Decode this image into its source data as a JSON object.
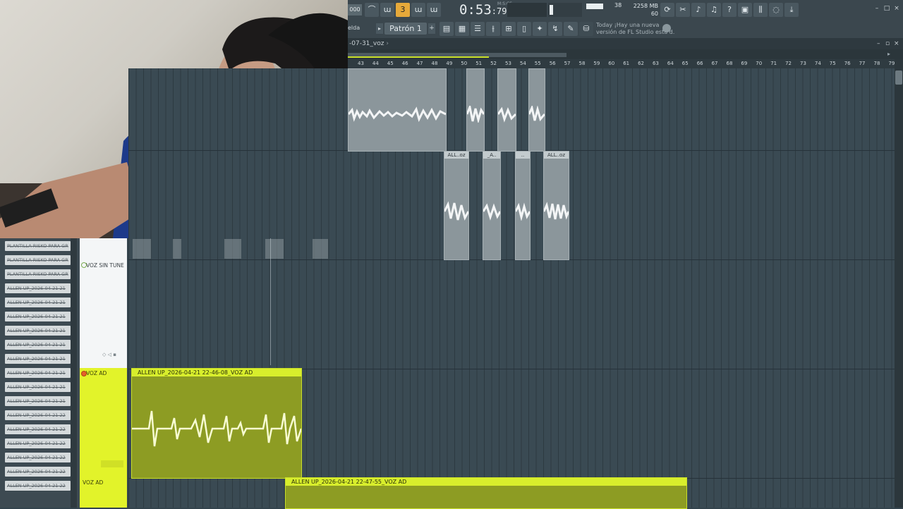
{
  "toolbar": {
    "clock_main": "0:53",
    "clock_sub": "79",
    "clock_unit": "M:S:CS",
    "cpu_voices": "38",
    "mem_value": "2258 MB",
    "mem_poly": "60",
    "left_value": "000",
    "buttons": [
      "line-icon",
      "wo-icon",
      "snap-icon",
      "wplus-icon",
      "wo2-icon"
    ],
    "right_buttons": [
      "refresh-icon",
      "cut-icon",
      "mic-icon",
      "mic2-icon",
      "help-icon",
      "save-icon",
      "mixer-icon",
      "chat-icon",
      "download-icon"
    ]
  },
  "toolbar2": {
    "left_label": "elda",
    "pattern_label": "Patrón 1",
    "hint_line1": "Today  ¡Hay una nueva",
    "hint_line2": "versión de FL Studio está d."
  },
  "playlist": {
    "title": "-07-31_voz",
    "ruler": [
      "43",
      "44",
      "45",
      "46",
      "47",
      "48",
      "49",
      "50",
      "51",
      "52",
      "53",
      "54",
      "55",
      "56",
      "57",
      "58",
      "59",
      "60",
      "61",
      "62",
      "63",
      "64",
      "65",
      "66",
      "67",
      "68",
      "69",
      "70",
      "71",
      "72",
      "73",
      "74",
      "75",
      "76",
      "77",
      "78",
      "79"
    ]
  },
  "clips": {
    "top_labels": [
      "ALL..oz",
      "_A..",
      "..",
      "ALL..oz"
    ],
    "clip1_label": "ALLEN UP_2026-04-21 22-46-08_VOZ AD",
    "clip2_label": "ALLEN UP_2026-04-21 22-47-55_VOZ AD"
  },
  "tracks": {
    "voz_sin_tune": "VOZ SIN TUNE",
    "voz_ad_1": "VOZ AD",
    "voz_ad_2": "VOZ AD"
  },
  "browser": {
    "items": [
      "PLANTILLA RISKO PARA GR",
      "PLANTILLA RISKO PARA GR",
      "PLANTILLA RISKO PARA GR",
      "ALLEN UP_2026-04-21 21",
      "ALLEN UP_2026-04-21 21",
      "ALLEN UP_2026-04-21 21",
      "ALLEN UP_2026-04-21 21",
      "ALLEN UP_2026-04-21 21",
      "ALLEN UP_2026-04-21 21",
      "ALLEN UP_2026-04-21 21",
      "ALLEN UP_2026-04-21 21",
      "ALLEN UP_2026-04-21 21",
      "ALLEN UP_2026-04-21 22",
      "ALLEN UP_2026-04-21 22",
      "ALLEN UP_2026-04-21 22",
      "ALLEN UP_2026-04-21 22",
      "ALLEN UP_2026-04-21 22",
      "ALLEN UP_2026-04-21 22"
    ]
  },
  "colors": {
    "accent_orange": "#e6a93a",
    "clip_yellow": "#d8ee2c",
    "track_bg": "#3a4a53"
  }
}
